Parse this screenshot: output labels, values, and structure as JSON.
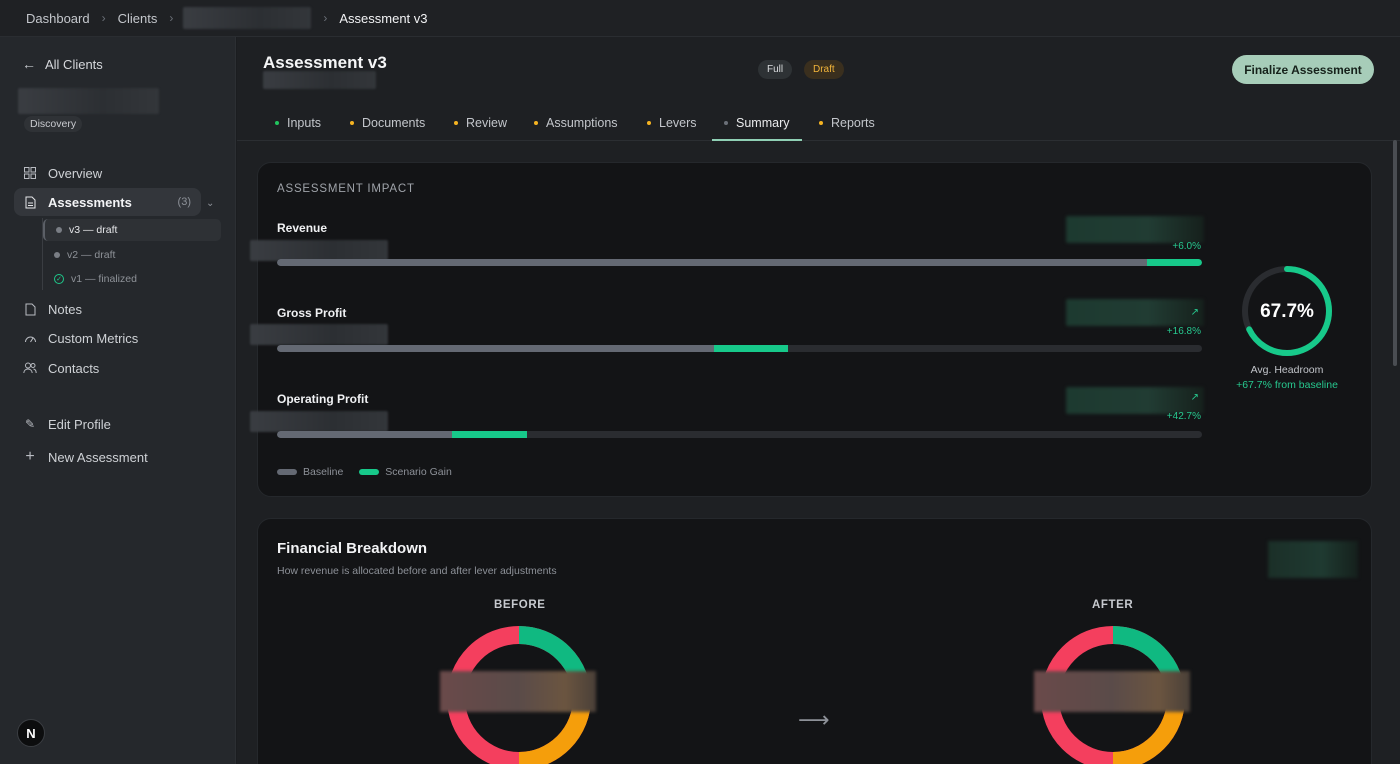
{
  "breadcrumb": {
    "items": [
      "Dashboard",
      "Clients"
    ],
    "current": "Assessment v3"
  },
  "sidebar": {
    "back_label": "All Clients",
    "stage_badge": "Discovery",
    "nav": [
      {
        "label": "Overview",
        "icon": "grid-icon"
      },
      {
        "label": "Assessments",
        "icon": "document-icon",
        "count": "(3)"
      },
      {
        "label": "Notes",
        "icon": "file-icon"
      },
      {
        "label": "Custom Metrics",
        "icon": "gauge-icon"
      },
      {
        "label": "Contacts",
        "icon": "users-icon"
      }
    ],
    "assessment_versions": [
      {
        "label": "v3 — draft",
        "state": "draft",
        "active": true
      },
      {
        "label": "v2 — draft",
        "state": "draft",
        "active": false
      },
      {
        "label": "v1 — finalized",
        "state": "finalized",
        "active": false
      }
    ],
    "actions": [
      {
        "label": "Edit Profile",
        "icon": "pencil-icon"
      },
      {
        "label": "New Assessment",
        "icon": "plus-icon"
      }
    ],
    "avatar_initial": "N"
  },
  "header": {
    "title": "Assessment v3",
    "badges": [
      "Full",
      "Draft"
    ],
    "finalize_label": "Finalize Assessment"
  },
  "tabs": [
    {
      "label": "Inputs",
      "dot_color": "#22c55e"
    },
    {
      "label": "Documents",
      "dot_color": "#f5b321"
    },
    {
      "label": "Review",
      "dot_color": "#f5b321"
    },
    {
      "label": "Assumptions",
      "dot_color": "#f5b321"
    },
    {
      "label": "Levers",
      "dot_color": "#f5b321"
    },
    {
      "label": "Summary",
      "dot_color": "#6b7078",
      "active": true
    },
    {
      "label": "Reports",
      "dot_color": "#f5b321"
    }
  ],
  "impact": {
    "section_label": "ASSESSMENT IMPACT",
    "metrics": [
      {
        "name": "Revenue",
        "change": "+6.0%",
        "baseline": 0.94,
        "gain": 0.06
      },
      {
        "name": "Gross Profit",
        "change": "+16.8%",
        "baseline": 0.472,
        "gain": 0.08
      },
      {
        "name": "Operating Profit",
        "change": "+42.7%",
        "baseline": 0.189,
        "gain": 0.081
      }
    ],
    "legend": {
      "baseline": "Baseline",
      "gain": "Scenario Gain"
    },
    "gauge": {
      "value_text": "67.7%",
      "value": 0.677,
      "label": "Avg. Headroom",
      "sub": "+67.7% from baseline"
    },
    "colors": {
      "baseline": "#646973",
      "gain": "#17c98a"
    }
  },
  "financial": {
    "title": "Financial Breakdown",
    "subtitle": "How revenue is allocated before and after lever adjustments",
    "before_label": "BEFORE",
    "after_label": "AFTER",
    "colors": {
      "red": "#f43f5e",
      "green": "#10b981",
      "orange": "#f59e0b"
    }
  }
}
